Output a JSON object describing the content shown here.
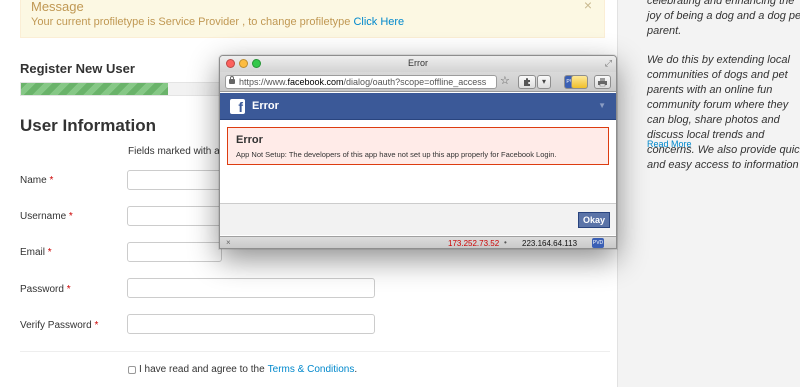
{
  "alert": {
    "title": "Message",
    "text": "Your current profiletype is Service Provider , to change profiletype",
    "link": "Click Here",
    "close": "×"
  },
  "form": {
    "register_title": "Register New User",
    "progress_fraction": 0.25,
    "section_title": "User Information",
    "fields_note": "Fields marked with an",
    "fields": [
      {
        "label": "Name",
        "required": "*",
        "value": ""
      },
      {
        "label": "Username",
        "required": "*",
        "value": ""
      },
      {
        "label": "Email",
        "required": "*",
        "value": ""
      },
      {
        "label": "Password",
        "required": "*",
        "value": ""
      },
      {
        "label": "Verify Password",
        "required": "*",
        "value": ""
      }
    ],
    "agree_text": "I have read and agree to the",
    "agree_link": "Terms & Conditions",
    "agree_end": "."
  },
  "sidebar": {
    "p1": "celebrating and enhancing the joy of being a dog and a dog pet parent.",
    "p2": "We do this by extending local communities of dogs and pet parents with an online fun community forum where they can blog, share photos and discuss local trends and concerns. We also provide quick and easy access to information",
    "read_more": "Read More"
  },
  "popup": {
    "window_title": "Error",
    "url_prefix": "https://www.",
    "url_domain": "facebook.com",
    "url_rest": "/dialog/oauth?scope=offline_access",
    "header_title": "Error",
    "error_title": "Error",
    "error_message": "App Not Setup: The developers of this app have not set up this app properly for Facebook Login.",
    "okay_label": "Okay",
    "status_ip1": "173.252.73.52",
    "status_dot": "•",
    "status_ip2": "223.164.64.113",
    "status_close": "×"
  },
  "icons": {
    "facebook": "f",
    "caret": "▼",
    "star": "☆",
    "resize": "⤢"
  },
  "colors": {
    "facebook_blue": "#3b5998",
    "link": "#0088cc",
    "alert_text": "#c09853",
    "error_border": "#dd3c10"
  }
}
